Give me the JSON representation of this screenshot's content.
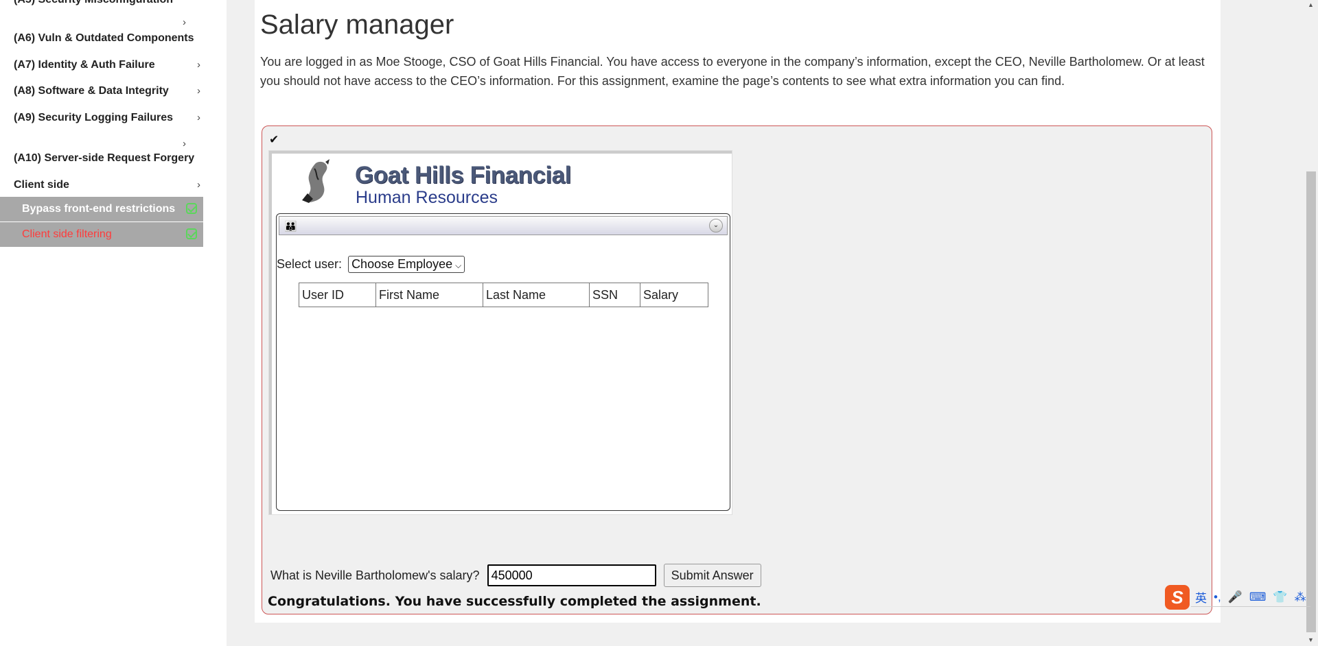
{
  "sidebar": {
    "truncated_item": "(A5) Security Misconfiguration",
    "items": [
      {
        "label": "(A6) Vuln & Outdated Components"
      },
      {
        "label": "(A7) Identity & Auth Failure"
      },
      {
        "label": "(A8) Software & Data Integrity"
      },
      {
        "label": "(A9) Security Logging Failures"
      },
      {
        "label": "(A10) Server-side Request Forgery"
      },
      {
        "label": "Client side"
      }
    ],
    "chevron": "›",
    "subitems": [
      {
        "label": "Bypass front-end restrictions",
        "color": "#ffffff"
      },
      {
        "label": "Client side filtering",
        "color": "#ff3b3b"
      }
    ]
  },
  "main": {
    "title": "Salary manager",
    "description": "You are logged in as Moe Stooge, CSO of Goat Hills Financial. You have access to everyone in the company’s information, except the CEO, Neville Bartholomew. Or at least you should not have access to the CEO’s information. For this assignment, examine the page’s contents to see what extra information you can find.",
    "assignment": {
      "done_icon": "✔",
      "widget": {
        "brand_name": "Goat Hills Financial",
        "brand_sub": "Human Resources",
        "people_icon": "👪",
        "collapse_icon": "⌄",
        "select_label": "Select user:",
        "select_value": "Choose Employee",
        "table_headers": [
          "User ID",
          "First Name",
          "Last Name",
          "SSN",
          "Salary"
        ]
      },
      "question": "What is Neville Bartholomew's salary?",
      "answer_value": "450000",
      "submit_label": "Submit Answer",
      "congrats": "Congratulations. You have successfully completed the assignment."
    }
  },
  "ime": {
    "logo": "S",
    "mode": "英",
    "punct": "•,",
    "mic": "🎤",
    "keyboard": "⌨",
    "skin": "👕",
    "menu": "⁂"
  },
  "colors": {
    "accent_border": "#cc5555",
    "check_green": "#5cd65c",
    "active_red": "#ff3b3b"
  }
}
